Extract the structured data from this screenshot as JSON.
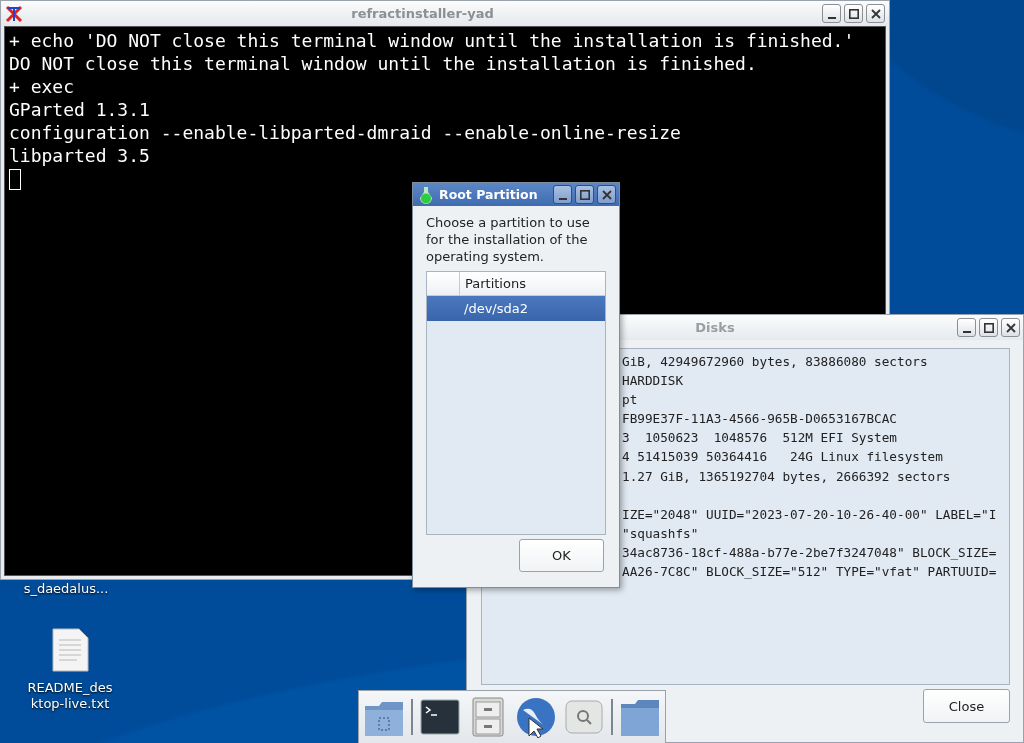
{
  "desktop": {
    "icons": [
      {
        "label": "s_daedalus..."
      },
      {
        "label": "README_desktop-live.txt"
      }
    ]
  },
  "terminal": {
    "title": "refractinstaller-yad",
    "lines": [
      "+ echo 'DO NOT close this terminal window until the installation is finished.'",
      "DO NOT close this terminal window until the installation is finished.",
      "+ exec",
      "GParted 1.3.1",
      "configuration --enable-libparted-dmraid --enable-online-resize",
      "libparted 3.5"
    ]
  },
  "dialog": {
    "title": "Root Partition",
    "message": "Choose a partition to use for the installation of the operating system.",
    "table": {
      "columns": [
        "Partitions"
      ],
      "rows": [
        {
          "value": "/dev/sda2",
          "selected": true
        }
      ]
    },
    "button": "OK"
  },
  "disks": {
    "title": "Disks",
    "blocks": [
      [
        "GiB, 42949672960 bytes, 83886080 sectors",
        "HARDDISK",
        "pt",
        "FB99E37F-11A3-4566-965B-D0653167BCAC",
        "3  1050623  1048576  512M EFI System",
        "4 51415039 50364416   24G Linux filesystem",
        "1.27 GiB, 1365192704 bytes, 2666392 sectors"
      ],
      [
        "IZE=\"2048\" UUID=\"2023-07-20-10-26-40-00\" LABEL=\"I",
        "\"squashfs\"",
        "34ac8736-18cf-488a-b77e-2be7f3247048\" BLOCK_SIZE=",
        "AA26-7C8C\" BLOCK_SIZE=\"512\" TYPE=\"vfat\" PARTUUID="
      ]
    ],
    "button": "Close"
  }
}
